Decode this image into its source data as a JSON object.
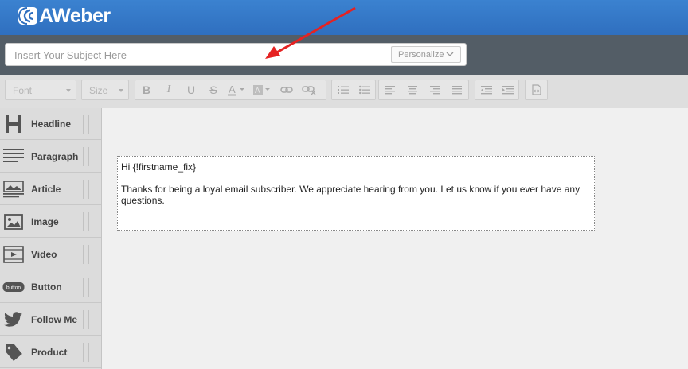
{
  "header": {
    "brand": "AWeber"
  },
  "subject": {
    "placeholder": "Insert Your Subject Here",
    "value": "",
    "personalize_label": "Personalize"
  },
  "toolbar": {
    "font_label": "Font",
    "size_label": "Size"
  },
  "sidebar": {
    "items": [
      {
        "label": "Headline",
        "icon": "headline-icon"
      },
      {
        "label": "Paragraph",
        "icon": "paragraph-icon"
      },
      {
        "label": "Article",
        "icon": "article-icon"
      },
      {
        "label": "Image",
        "icon": "image-icon"
      },
      {
        "label": "Video",
        "icon": "video-icon"
      },
      {
        "label": "Button",
        "icon": "button-icon",
        "icon_text": "button"
      },
      {
        "label": "Follow Me",
        "icon": "twitter-bird-icon"
      },
      {
        "label": "Product",
        "icon": "price-tag-icon"
      }
    ]
  },
  "editor": {
    "greeting": "Hi {!firstname_fix}",
    "body": "Thanks for being a loyal email subscriber. We appreciate hearing from you. Let us know if you ever have any questions."
  },
  "colors": {
    "topbar": "#3b82d0",
    "subjectbar": "#535d66",
    "arrow": "#e52222"
  }
}
